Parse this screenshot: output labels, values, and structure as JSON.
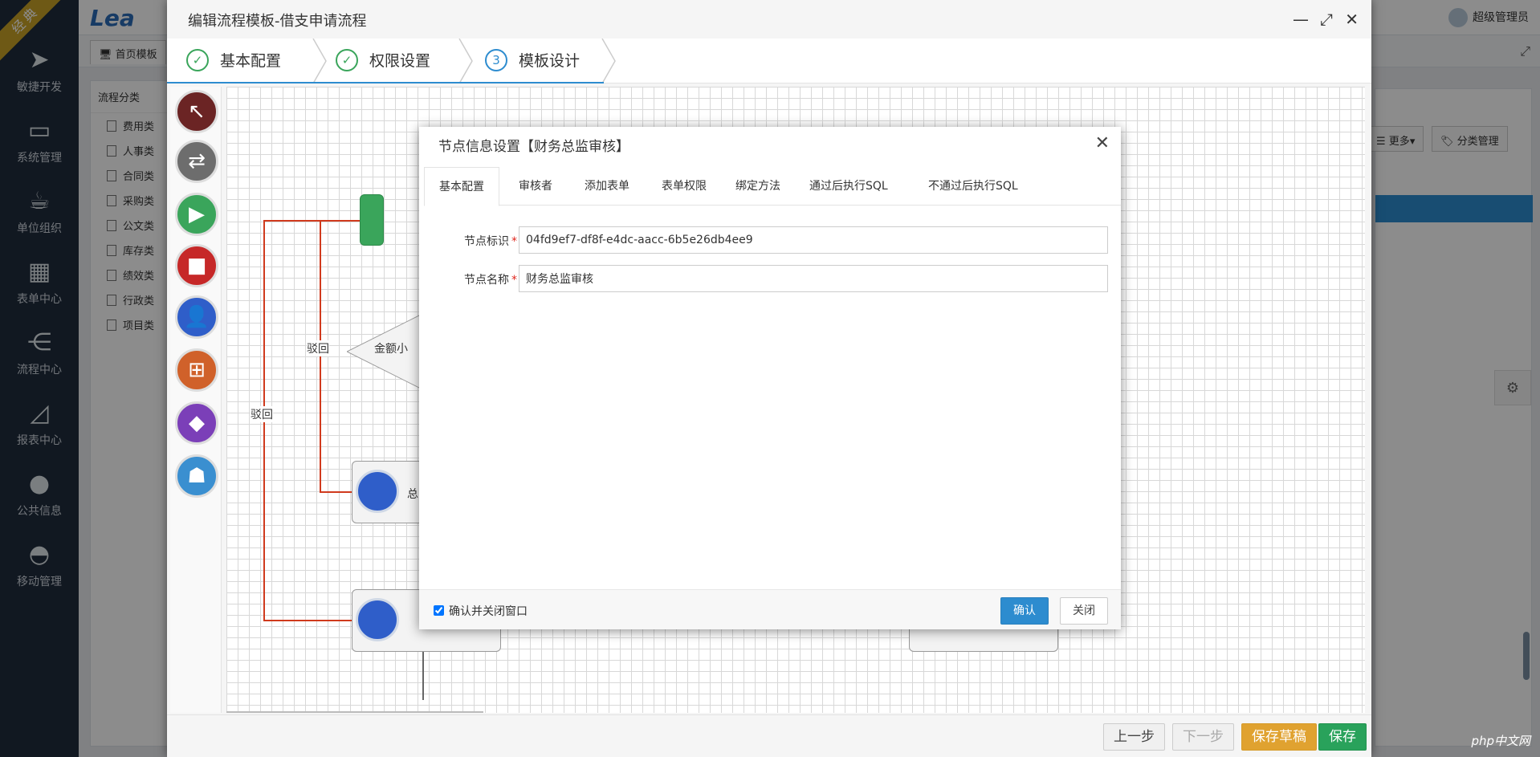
{
  "nav": {
    "badge": "经典",
    "items": [
      {
        "label": "敏捷开发",
        "icon": "paper-plane-icon"
      },
      {
        "label": "系统管理",
        "icon": "monitor-icon"
      },
      {
        "label": "单位组织",
        "icon": "coffee-cup-icon"
      },
      {
        "label": "表单中心",
        "icon": "table-grid-icon"
      },
      {
        "label": "流程中心",
        "icon": "share-nodes-icon"
      },
      {
        "label": "报表中心",
        "icon": "area-chart-icon"
      },
      {
        "label": "公共信息",
        "icon": "globe-icon"
      },
      {
        "label": "移动管理",
        "icon": "android-icon"
      }
    ]
  },
  "appbar": {
    "logo": "Lea",
    "user": "超级管理员"
  },
  "tabbar": {
    "home": "首页模板"
  },
  "side": {
    "title": "流程分类",
    "items": [
      "费用类",
      "人事类",
      "合同类",
      "采购类",
      "公文类",
      "库存类",
      "绩效类",
      "行政类",
      "项目类"
    ]
  },
  "rightpanel": {
    "more": "更多",
    "category": "分类管理"
  },
  "window": {
    "title": "编辑流程模板-借支申请流程",
    "steps": [
      {
        "label": "基本配置",
        "mark": "✓"
      },
      {
        "label": "权限设置",
        "mark": "✓"
      },
      {
        "label": "模板设计",
        "mark": "3"
      }
    ],
    "canvas": {
      "reject1": "驳回",
      "reject2": "驳回",
      "condition": "金额小",
      "node_fragment": "总"
    },
    "footer": {
      "prev": "上一步",
      "next": "下一步",
      "save_draft": "保存草稿",
      "save": "保存"
    }
  },
  "dialog": {
    "title": "节点信息设置【财务总监审核】",
    "tabs": [
      "基本配置",
      "审核者",
      "添加表单",
      "表单权限",
      "绑定方法",
      "通过后执行SQL",
      "不通过后执行SQL"
    ],
    "fields": {
      "node_id_label": "节点标识",
      "node_id_value": "04fd9ef7-df8f-e4dc-aacc-6b5e26db4ee9",
      "node_name_label": "节点名称",
      "node_name_value": "财务总监审核"
    },
    "footer": {
      "checkbox_label": "确认并关闭窗口",
      "confirm": "确认",
      "close": "关闭"
    }
  },
  "watermark": "php中文网",
  "colors": {
    "primary": "#2d8ccf",
    "success": "#29a25b",
    "warning": "#e0a230",
    "danger": "#d03a1d",
    "nav": "#1f2d3d"
  }
}
